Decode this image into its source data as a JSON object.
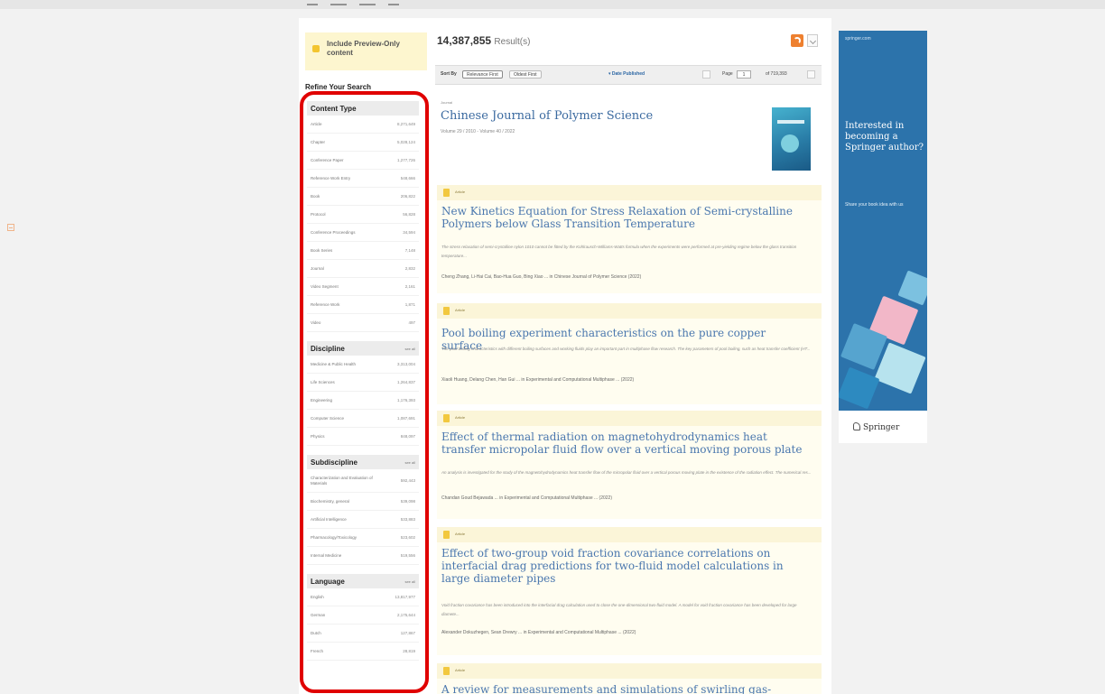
{
  "results": {
    "count": "14,387,855",
    "label": "Result(s)"
  },
  "preview": {
    "label": "Include Preview-Only content"
  },
  "refine_label": "Refine Your Search",
  "facets": [
    {
      "title": "Content Type",
      "see_all": "",
      "rows": [
        {
          "label": "Article",
          "count": "8,271,649",
          "h": 10
        },
        {
          "label": "Chapter",
          "count": "5,028,124",
          "h": 10
        },
        {
          "label": "Conference Paper",
          "count": "1,277,726",
          "h": 10
        },
        {
          "label": "Reference Work Entry",
          "count": "548,666",
          "h": 10
        },
        {
          "label": "Book",
          "count": "206,822",
          "h": 10
        },
        {
          "label": "Protocol",
          "count": "56,828",
          "h": 10
        },
        {
          "label": "Conference Proceedings",
          "count": "34,594",
          "h": 10
        },
        {
          "label": "Book Series",
          "count": "7,148",
          "h": 10
        },
        {
          "label": "Journal",
          "count": "2,832",
          "h": 10
        },
        {
          "label": "Video Segment",
          "count": "2,161",
          "h": 10
        },
        {
          "label": "Reference Work",
          "count": "1,871",
          "h": 10
        },
        {
          "label": "Video",
          "count": "497",
          "h": 10
        }
      ]
    },
    {
      "title": "Discipline",
      "see_all": "see all",
      "rows": [
        {
          "label": "Medicine & Public Health",
          "count": "3,313,004",
          "h": 10
        },
        {
          "label": "Life Sciences",
          "count": "1,264,837",
          "h": 10
        },
        {
          "label": "Engineering",
          "count": "1,176,393",
          "h": 10
        },
        {
          "label": "Computer Science",
          "count": "1,087,691",
          "h": 10
        },
        {
          "label": "Physics",
          "count": "848,097",
          "h": 10
        }
      ]
    },
    {
      "title": "Subdiscipline",
      "see_all": "see all",
      "rows": [
        {
          "label": "Characterization and Evaluation of Materials",
          "count": "592,443",
          "h": 16
        },
        {
          "label": "Biochemistry, general",
          "count": "539,098",
          "h": 10
        },
        {
          "label": "Artificial Intelligence",
          "count": "533,883",
          "h": 10
        },
        {
          "label": "Pharmacology/Toxicology",
          "count": "523,602",
          "h": 10
        },
        {
          "label": "Internal Medicine",
          "count": "519,556",
          "h": 10
        }
      ]
    },
    {
      "title": "Language",
      "see_all": "see all",
      "rows": [
        {
          "label": "English",
          "count": "13,817,977",
          "h": 10
        },
        {
          "label": "German",
          "count": "2,175,644",
          "h": 10
        },
        {
          "label": "Dutch",
          "count": "127,867",
          "h": 10
        },
        {
          "label": "French",
          "count": "28,819",
          "h": 10
        }
      ]
    }
  ],
  "sort": {
    "label": "Sort By",
    "relevance": "Relevance First",
    "oldest": "Oldest First",
    "date_published": "Date Published",
    "page_label": "Page",
    "page_value": "1",
    "of": "of 719,393"
  },
  "journal": {
    "type": "Journal",
    "title": "Chinese Journal of Polymer Science",
    "volumes": "Volume 29 / 2010 - Volume 40 / 2022"
  },
  "articles": [
    {
      "type": "Article",
      "title": "New Kinetics Equation for Stress Relaxation of Semi-crystalline Polymers below Glass Transition Temperature",
      "snippet": "The stress relaxation of semi-crystalline nylon 1010 cannot be fitted by the Kohlrausch-Williams-Watts formula when the experiments were performed at pre-yielding regime below the glass transition temperature...",
      "meta": "Cheng Zhang, Li-Hai Cai, Bao-Hua Guo, Bing Xiao ... in Chinese Journal of Polymer Science (2022)"
    },
    {
      "type": "Article",
      "title": "Pool boiling experiment characteristics on the pure copper surface",
      "snippet": "The pool boiling characteristics with different boiling surfaces and working fluids play an important part in multiphase flow research. The key parameters of pool boiling, such as heat transfer coefficient (HT...",
      "meta": "Xiaoli Huang, Delang Chen, Han Gui ... in Experimental and Computational Multiphase ... (2022)"
    },
    {
      "type": "Article",
      "title": "Effect of thermal radiation on magnetohydrodynamics heat transfer micropolar fluid flow over a vertical moving porous plate",
      "snippet": "An analysis is investigated for the study of the magnetohydrodynamics heat transfer flow of the micropolar fluid over a vertical porous moving plate in the existence of the radiation effect. The numerical res...",
      "meta": "Chandan Goud Bejawada ... in Experimental and Computational Multiphase ... (2022)"
    },
    {
      "type": "Article",
      "title": "Effect of two-group void fraction covariance correlations on interfacial drag predictions for two-fluid model calculations in large diameter pipes",
      "snippet": "Void fraction covariance has been introduced into the interfacial drag calculation used to close the one-dimensional two-fluid model. A model for void fraction covariance has been developed for large diamete...",
      "meta": "Alexander Dokuzhegen, Sean Drewry ... in Experimental and Computational Multiphase ... (2022)"
    },
    {
      "type": "Article",
      "title": "A review for measurements and simulations of swirling gas-particle",
      "snippet": "",
      "meta": ""
    }
  ],
  "ad": {
    "domain": "springer.com",
    "headline": "Interested in becoming a Springer author?",
    "subline": "Share your book idea with us",
    "logo": "Springer"
  },
  "colors": {
    "accent_link": "#4a77ae",
    "callout": "#e00000",
    "ad_blue": "#2c73ab"
  }
}
